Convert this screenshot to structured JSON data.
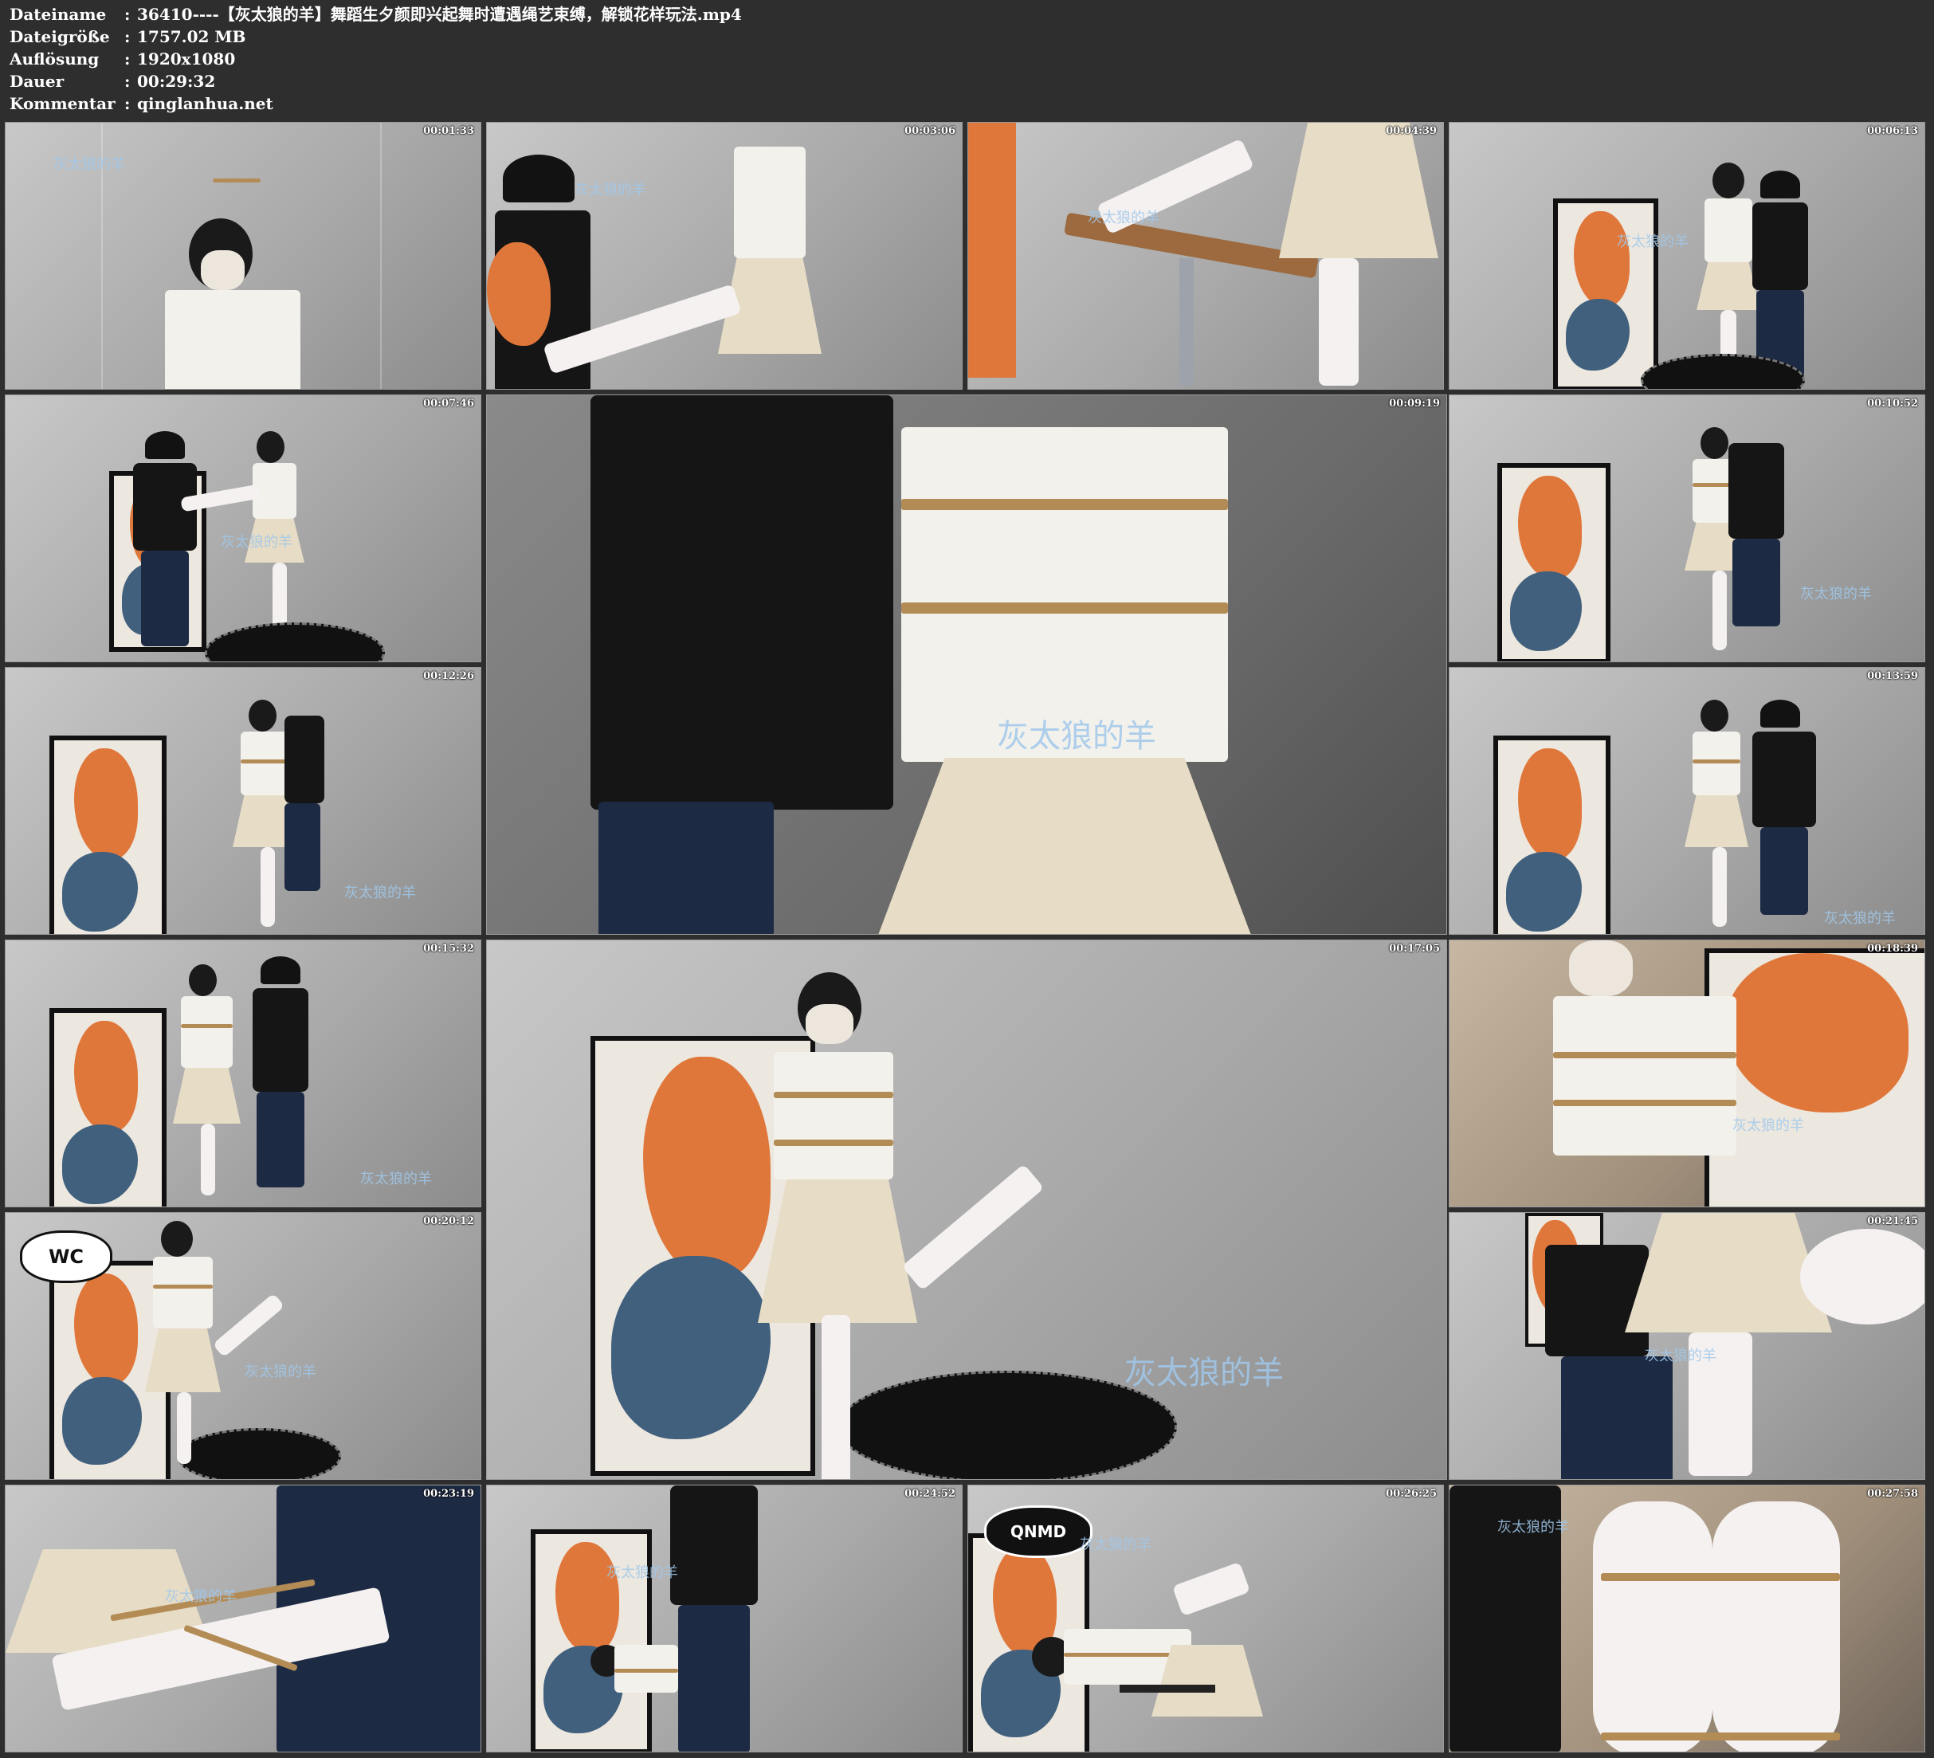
{
  "header": {
    "rows": [
      {
        "key": "Dateiname",
        "sep": ":",
        "value": "36410----【灰太狼的羊】舞蹈生夕颜即兴起舞时遭遇绳艺束缚，解锁花样玩法.mp4"
      },
      {
        "key": "Dateigröße",
        "sep": ":",
        "value": "1757.02 MB"
      },
      {
        "key": "Auflösung",
        "sep": ":",
        "value": "1920x1080"
      },
      {
        "key": "Dauer",
        "sep": ":",
        "value": "00:29:32"
      },
      {
        "key": "Kommentar",
        "sep": ":",
        "value": "qinglanhua.net"
      }
    ]
  },
  "watermark_text": "灰太狼的羊",
  "bubbles": {
    "wc": "WC",
    "qnmd": "QNMD"
  },
  "thumbnails": [
    {
      "timestamp": "00:01:33"
    },
    {
      "timestamp": "00:03:06"
    },
    {
      "timestamp": "00:04:39"
    },
    {
      "timestamp": "00:06:13"
    },
    {
      "timestamp": "00:07:46"
    },
    {
      "timestamp": "00:09:19"
    },
    {
      "timestamp": "00:10:52"
    },
    {
      "timestamp": "00:12:26"
    },
    {
      "timestamp": "00:13:59"
    },
    {
      "timestamp": "00:15:32"
    },
    {
      "timestamp": "00:17:05"
    },
    {
      "timestamp": "00:18:39"
    },
    {
      "timestamp": "00:20:12"
    },
    {
      "timestamp": "00:21:45"
    },
    {
      "timestamp": "00:23:19"
    },
    {
      "timestamp": "00:24:52"
    },
    {
      "timestamp": "00:26:25"
    },
    {
      "timestamp": "00:27:58"
    }
  ],
  "colors": {
    "background": "#2e2e2e",
    "text": "#ffffff",
    "rope": "#b38b55",
    "poster_orange": "#e0773a",
    "poster_blue": "#41607d"
  }
}
